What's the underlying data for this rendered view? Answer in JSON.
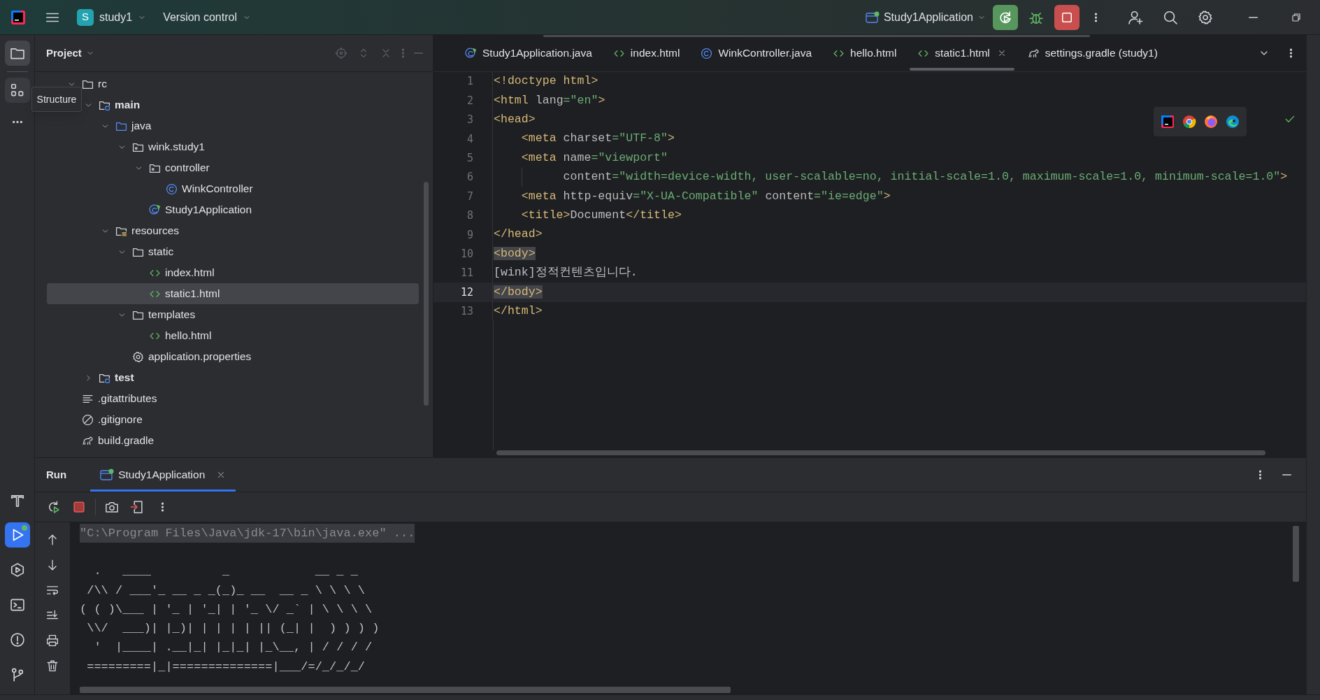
{
  "top_bar": {
    "project_badge": "S",
    "project": "study1",
    "vcs": "Version control",
    "run_config": "Study1Application"
  },
  "tool_windows": [
    {
      "kind": "project",
      "selected": true,
      "hovered": false
    },
    {
      "kind": "structure",
      "selected": false,
      "hovered": true
    },
    {
      "kind": "build",
      "selected": false,
      "hovered": false
    },
    {
      "kind": "run",
      "selected": true,
      "hovered": false
    },
    {
      "kind": "services",
      "selected": false,
      "hovered": false
    },
    {
      "kind": "terminal",
      "selected": false,
      "hovered": false
    },
    {
      "kind": "problems",
      "selected": false,
      "hovered": false
    },
    {
      "kind": "git",
      "selected": false,
      "hovered": false
    }
  ],
  "tooltip": "Structure",
  "project_panel": {
    "title": "Project",
    "tree": [
      {
        "label": "rc",
        "kind": "folder",
        "expanded": true,
        "selected": false,
        "children": [
          {
            "label": "main",
            "kind": "source-root",
            "expanded": true,
            "selected": false,
            "children": [
              {
                "label": "java",
                "kind": "java-folder",
                "expanded": true,
                "selected": false,
                "children": [
                  {
                    "label": "wink.study1",
                    "kind": "package",
                    "expanded": true,
                    "selected": false,
                    "children": [
                      {
                        "label": "controller",
                        "kind": "package",
                        "expanded": true,
                        "selected": false,
                        "children": [
                          {
                            "label": "WinkController",
                            "kind": "class",
                            "selected": false
                          }
                        ]
                      },
                      {
                        "label": "Study1Application",
                        "kind": "app-class",
                        "selected": false
                      }
                    ]
                  }
                ]
              },
              {
                "label": "resources",
                "kind": "resources-folder",
                "expanded": true,
                "selected": false,
                "children": [
                  {
                    "label": "static",
                    "kind": "folder",
                    "expanded": true,
                    "selected": false,
                    "children": [
                      {
                        "label": "index.html",
                        "kind": "html",
                        "selected": false
                      },
                      {
                        "label": "static1.html",
                        "kind": "html",
                        "selected": true
                      }
                    ]
                  },
                  {
                    "label": "templates",
                    "kind": "folder",
                    "expanded": true,
                    "selected": false,
                    "children": [
                      {
                        "label": "hello.html",
                        "kind": "html",
                        "selected": false
                      }
                    ]
                  },
                  {
                    "label": "application.properties",
                    "kind": "properties",
                    "selected": false
                  }
                ]
              }
            ]
          },
          {
            "label": "test",
            "kind": "source-root",
            "expanded": false,
            "selected": false
          }
        ]
      },
      {
        "label": ".gitattributes",
        "kind": "text",
        "selected": false
      },
      {
        "label": ".gitignore",
        "kind": "ignore",
        "selected": false
      },
      {
        "label": "build.gradle",
        "kind": "gradle",
        "selected": false
      }
    ]
  },
  "editor": {
    "tabs": [
      {
        "label": "Study1Application.java",
        "kind": "app-class",
        "selected": false
      },
      {
        "label": "index.html",
        "kind": "html",
        "selected": false
      },
      {
        "label": "WinkController.java",
        "kind": "class",
        "selected": false
      },
      {
        "label": "hello.html",
        "kind": "html",
        "selected": false
      },
      {
        "label": "static1.html",
        "kind": "html",
        "selected": true
      },
      {
        "label": "settings.gradle (study1)",
        "kind": "gradle",
        "selected": false
      }
    ],
    "lines": [
      {
        "number": "1",
        "current": false,
        "tokens": [
          {
            "kind": "tag",
            "text": "<!doctype html>"
          }
        ]
      },
      {
        "number": "2",
        "current": false,
        "tokens": [
          {
            "kind": "tag",
            "text": "<html"
          },
          {
            "kind": "attr",
            "text": " lang"
          },
          {
            "kind": "value",
            "text": "=\"en\""
          },
          {
            "kind": "tag",
            "text": ">"
          }
        ]
      },
      {
        "number": "3",
        "current": false,
        "tokens": [
          {
            "kind": "tag",
            "text": "<head>"
          }
        ]
      },
      {
        "number": "4",
        "current": false,
        "tokens": [
          {
            "kind": "tag",
            "text": "    <meta"
          },
          {
            "kind": "attr",
            "text": " charset"
          },
          {
            "kind": "value",
            "text": "=\"UTF-8\""
          },
          {
            "kind": "tag",
            "text": ">"
          }
        ]
      },
      {
        "number": "5",
        "current": false,
        "tokens": [
          {
            "kind": "tag",
            "text": "    <meta"
          },
          {
            "kind": "attr",
            "text": " name"
          },
          {
            "kind": "value",
            "text": "=\"viewport\""
          }
        ]
      },
      {
        "number": "6",
        "current": false,
        "guide": true,
        "tokens": [
          {
            "kind": "attr",
            "text": "          content"
          },
          {
            "kind": "value",
            "text": "=\"width=device-width, user-scalable=no, initial-scale=1.0, maximum-scale=1.0, minimum-scale=1.0\""
          },
          {
            "kind": "tag",
            "text": ">"
          }
        ]
      },
      {
        "number": "7",
        "current": false,
        "tokens": [
          {
            "kind": "tag",
            "text": "    <meta"
          },
          {
            "kind": "attr",
            "text": " http-equiv"
          },
          {
            "kind": "value",
            "text": "=\"X-UA-Compatible\""
          },
          {
            "kind": "attr",
            "text": " content"
          },
          {
            "kind": "value",
            "text": "=\"ie=edge\""
          },
          {
            "kind": "tag",
            "text": ">"
          }
        ]
      },
      {
        "number": "8",
        "current": false,
        "tokens": [
          {
            "kind": "tag",
            "text": "    <title>"
          },
          {
            "kind": "text",
            "text": "Document"
          },
          {
            "kind": "tag",
            "text": "</title>"
          }
        ]
      },
      {
        "number": "9",
        "current": false,
        "tokens": [
          {
            "kind": "tag",
            "text": "</head>"
          }
        ]
      },
      {
        "number": "10",
        "current": false,
        "tokens": [
          {
            "kind": "tag",
            "text": "<body>",
            "matched": true
          }
        ]
      },
      {
        "number": "11",
        "current": false,
        "tokens": [
          {
            "kind": "text",
            "text": "[wink]정적컨텐츠입니다."
          }
        ]
      },
      {
        "number": "12",
        "current": true,
        "tokens": [
          {
            "kind": "tag",
            "text": "</body>",
            "matched": true
          }
        ]
      },
      {
        "number": "13",
        "current": false,
        "tokens": [
          {
            "kind": "tag",
            "text": "</html>"
          }
        ]
      }
    ]
  },
  "run_panel": {
    "title": "Run",
    "tabs": [
      {
        "label": "Study1Application",
        "selected": true
      }
    ],
    "console": [
      {
        "kind": "command",
        "text": "\"C:\\Program Files\\Java\\jdk-17\\bin\\java.exe\" ..."
      },
      {
        "kind": "output",
        "text": "  .   ____          _            __ _ _"
      },
      {
        "kind": "output",
        "text": " /\\\\ / ___'_ __ _ _(_)_ __  __ _ \\ \\ \\ \\"
      },
      {
        "kind": "output",
        "text": "( ( )\\___ | '_ | '_| | '_ \\/ _` | \\ \\ \\ \\"
      },
      {
        "kind": "output",
        "text": " \\\\/  ___)| |_)| | | | | || (_| |  ) ) ) )"
      },
      {
        "kind": "output",
        "text": "  '  |____| .__|_| |_|_| |_\\__, | / / / /"
      },
      {
        "kind": "output",
        "text": " =========|_|==============|___/=/_/_/_/"
      }
    ]
  }
}
